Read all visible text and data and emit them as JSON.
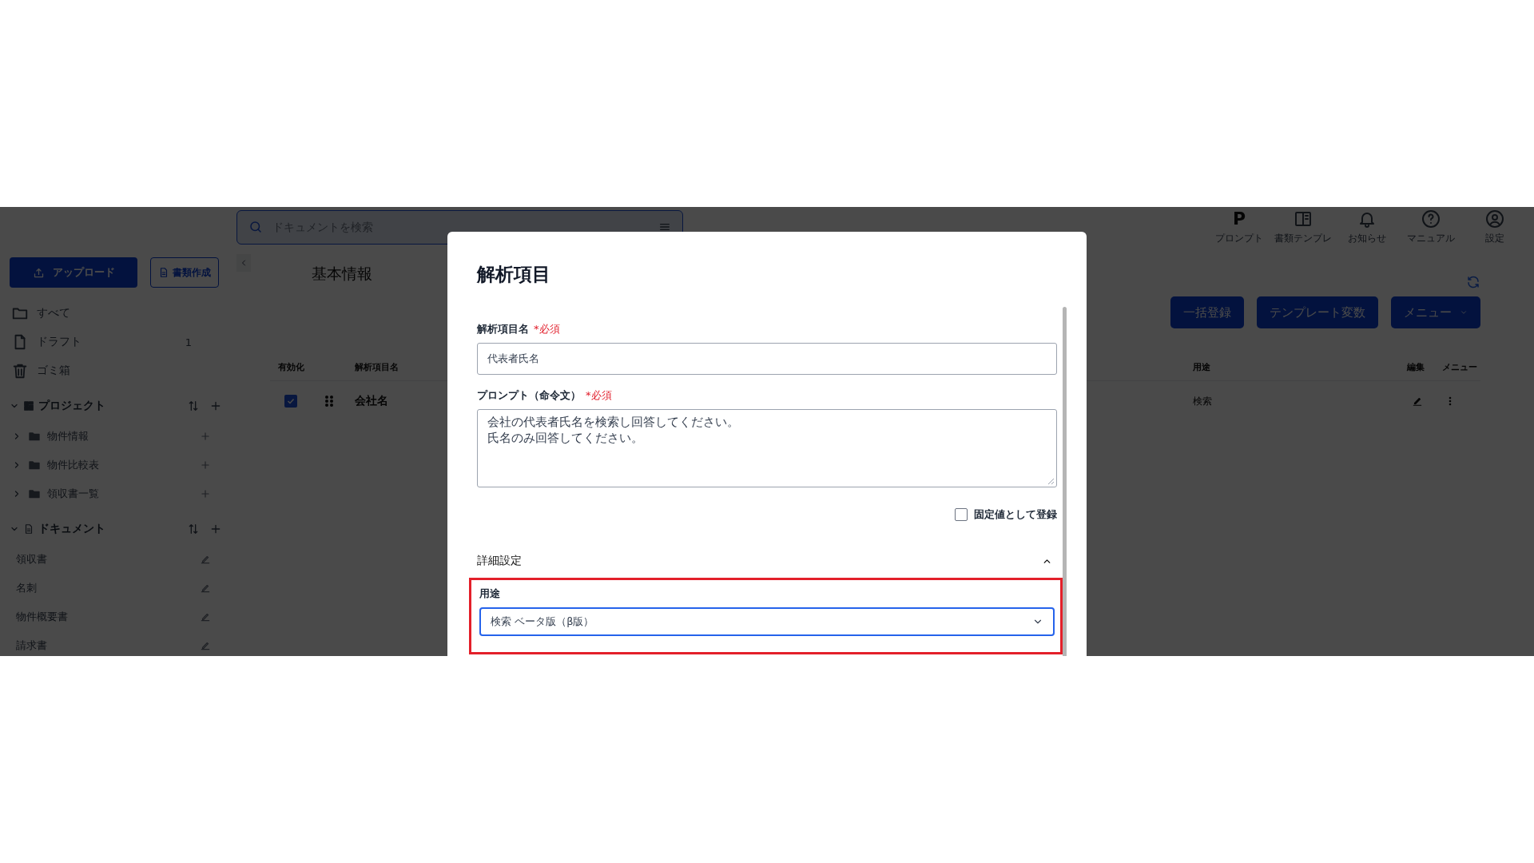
{
  "search": {
    "placeholder": "ドキュメントを検索"
  },
  "nav": [
    {
      "kind": "letter",
      "glyph": "P",
      "label": "プロンプト"
    },
    {
      "kind": "book",
      "label": "書類テンプレ"
    },
    {
      "kind": "bell",
      "label": "お知らせ"
    },
    {
      "kind": "help",
      "label": "マニュアル"
    },
    {
      "kind": "user",
      "label": "設定"
    }
  ],
  "sidebar": {
    "upload_button": "アップロード",
    "create_button": "書類作成",
    "items": [
      {
        "kind": "folder",
        "label": "すべて"
      },
      {
        "kind": "file",
        "label": "ドラフト",
        "count": "1"
      },
      {
        "kind": "trash",
        "label": "ゴミ箱"
      }
    ],
    "sections": [
      {
        "kind": "project",
        "title": "プロジェクト",
        "expanded": true,
        "items": [
          {
            "label": "物件情報",
            "expanded": false
          },
          {
            "label": "物件比較表",
            "expanded": false
          },
          {
            "label": "領収書一覧",
            "expanded": false
          }
        ]
      },
      {
        "kind": "document",
        "title": "ドキュメント",
        "expanded": true,
        "items": [
          {
            "label": "領収書"
          },
          {
            "label": "名刺"
          },
          {
            "label": "物件概要書"
          },
          {
            "label": "請求書"
          }
        ]
      }
    ]
  },
  "main": {
    "title": "基本情報",
    "buttons": [
      {
        "label": "一括登録",
        "caret": false
      },
      {
        "label": "テンプレート変数",
        "caret": false
      },
      {
        "label": "メニュー",
        "caret": true
      }
    ],
    "table": {
      "columns": [
        "有効化",
        "解析項目名",
        "用途",
        "編集",
        "メニュー"
      ],
      "rows": [
        {
          "enabled": true,
          "name": "会社名",
          "usage": "検索"
        }
      ]
    }
  },
  "modal": {
    "title": "解析項目",
    "name_field": {
      "label": "解析項目名",
      "required": "*必須",
      "value": "代表者氏名"
    },
    "prompt_field": {
      "label": "プロンプト（命令文）",
      "required": "*必須",
      "lines": [
        "会社の代表者氏名を検索し回答してください。",
        "氏名のみ回答してください。"
      ]
    },
    "fixed_checkbox": {
      "label": "固定値として登録",
      "checked": false
    },
    "advanced": {
      "title": "詳細設定",
      "expanded": true,
      "usage": {
        "label": "用途",
        "value": "検索 ベータ版（β版）",
        "highlighted": true
      }
    }
  }
}
